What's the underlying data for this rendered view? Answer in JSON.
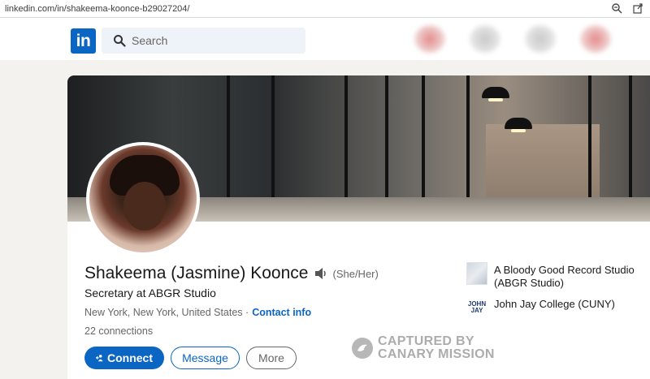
{
  "browser": {
    "url": "linkedin.com/in/shakeema-koonce-b29027204/"
  },
  "header": {
    "logo_text": "in",
    "search_placeholder": "Search"
  },
  "profile": {
    "name": "Shakeema (Jasmine) Koonce",
    "pronouns": "(She/Her)",
    "headline": "Secretary at ABGR Studio",
    "location": "New York, New York, United States ·",
    "contact_info": "Contact info",
    "connections": "22 connections"
  },
  "actions": {
    "connect_label": "Connect",
    "message_label": "Message",
    "more_label": "More"
  },
  "experience": [
    {
      "label": "A Bloody Good Record Studio (ABGR Studio)",
      "logo": "abgr-logo"
    },
    {
      "label": "John Jay College (CUNY)",
      "logo": "john-jay-logo",
      "logo_text": "JOHN JAY"
    }
  ],
  "watermark": {
    "line1": "CAPTURED BY",
    "line2": "CANARY MISSION"
  },
  "colors": {
    "brand": "#0a66c2",
    "text": "#191919",
    "secondary_text": "#666666"
  }
}
